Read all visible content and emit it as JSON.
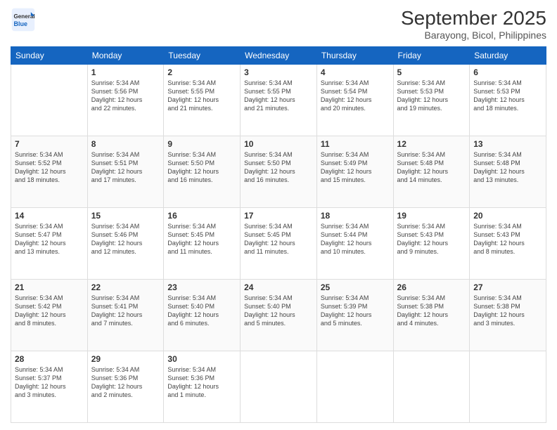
{
  "header": {
    "logo_general": "General",
    "logo_blue": "Blue",
    "month": "September 2025",
    "location": "Barayong, Bicol, Philippines"
  },
  "days_of_week": [
    "Sunday",
    "Monday",
    "Tuesday",
    "Wednesday",
    "Thursday",
    "Friday",
    "Saturday"
  ],
  "weeks": [
    [
      {
        "day": "",
        "info": ""
      },
      {
        "day": "1",
        "info": "Sunrise: 5:34 AM\nSunset: 5:56 PM\nDaylight: 12 hours\nand 22 minutes."
      },
      {
        "day": "2",
        "info": "Sunrise: 5:34 AM\nSunset: 5:55 PM\nDaylight: 12 hours\nand 21 minutes."
      },
      {
        "day": "3",
        "info": "Sunrise: 5:34 AM\nSunset: 5:55 PM\nDaylight: 12 hours\nand 21 minutes."
      },
      {
        "day": "4",
        "info": "Sunrise: 5:34 AM\nSunset: 5:54 PM\nDaylight: 12 hours\nand 20 minutes."
      },
      {
        "day": "5",
        "info": "Sunrise: 5:34 AM\nSunset: 5:53 PM\nDaylight: 12 hours\nand 19 minutes."
      },
      {
        "day": "6",
        "info": "Sunrise: 5:34 AM\nSunset: 5:53 PM\nDaylight: 12 hours\nand 18 minutes."
      }
    ],
    [
      {
        "day": "7",
        "info": "Sunrise: 5:34 AM\nSunset: 5:52 PM\nDaylight: 12 hours\nand 18 minutes."
      },
      {
        "day": "8",
        "info": "Sunrise: 5:34 AM\nSunset: 5:51 PM\nDaylight: 12 hours\nand 17 minutes."
      },
      {
        "day": "9",
        "info": "Sunrise: 5:34 AM\nSunset: 5:50 PM\nDaylight: 12 hours\nand 16 minutes."
      },
      {
        "day": "10",
        "info": "Sunrise: 5:34 AM\nSunset: 5:50 PM\nDaylight: 12 hours\nand 16 minutes."
      },
      {
        "day": "11",
        "info": "Sunrise: 5:34 AM\nSunset: 5:49 PM\nDaylight: 12 hours\nand 15 minutes."
      },
      {
        "day": "12",
        "info": "Sunrise: 5:34 AM\nSunset: 5:48 PM\nDaylight: 12 hours\nand 14 minutes."
      },
      {
        "day": "13",
        "info": "Sunrise: 5:34 AM\nSunset: 5:48 PM\nDaylight: 12 hours\nand 13 minutes."
      }
    ],
    [
      {
        "day": "14",
        "info": "Sunrise: 5:34 AM\nSunset: 5:47 PM\nDaylight: 12 hours\nand 13 minutes."
      },
      {
        "day": "15",
        "info": "Sunrise: 5:34 AM\nSunset: 5:46 PM\nDaylight: 12 hours\nand 12 minutes."
      },
      {
        "day": "16",
        "info": "Sunrise: 5:34 AM\nSunset: 5:45 PM\nDaylight: 12 hours\nand 11 minutes."
      },
      {
        "day": "17",
        "info": "Sunrise: 5:34 AM\nSunset: 5:45 PM\nDaylight: 12 hours\nand 11 minutes."
      },
      {
        "day": "18",
        "info": "Sunrise: 5:34 AM\nSunset: 5:44 PM\nDaylight: 12 hours\nand 10 minutes."
      },
      {
        "day": "19",
        "info": "Sunrise: 5:34 AM\nSunset: 5:43 PM\nDaylight: 12 hours\nand 9 minutes."
      },
      {
        "day": "20",
        "info": "Sunrise: 5:34 AM\nSunset: 5:43 PM\nDaylight: 12 hours\nand 8 minutes."
      }
    ],
    [
      {
        "day": "21",
        "info": "Sunrise: 5:34 AM\nSunset: 5:42 PM\nDaylight: 12 hours\nand 8 minutes."
      },
      {
        "day": "22",
        "info": "Sunrise: 5:34 AM\nSunset: 5:41 PM\nDaylight: 12 hours\nand 7 minutes."
      },
      {
        "day": "23",
        "info": "Sunrise: 5:34 AM\nSunset: 5:40 PM\nDaylight: 12 hours\nand 6 minutes."
      },
      {
        "day": "24",
        "info": "Sunrise: 5:34 AM\nSunset: 5:40 PM\nDaylight: 12 hours\nand 5 minutes."
      },
      {
        "day": "25",
        "info": "Sunrise: 5:34 AM\nSunset: 5:39 PM\nDaylight: 12 hours\nand 5 minutes."
      },
      {
        "day": "26",
        "info": "Sunrise: 5:34 AM\nSunset: 5:38 PM\nDaylight: 12 hours\nand 4 minutes."
      },
      {
        "day": "27",
        "info": "Sunrise: 5:34 AM\nSunset: 5:38 PM\nDaylight: 12 hours\nand 3 minutes."
      }
    ],
    [
      {
        "day": "28",
        "info": "Sunrise: 5:34 AM\nSunset: 5:37 PM\nDaylight: 12 hours\nand 3 minutes."
      },
      {
        "day": "29",
        "info": "Sunrise: 5:34 AM\nSunset: 5:36 PM\nDaylight: 12 hours\nand 2 minutes."
      },
      {
        "day": "30",
        "info": "Sunrise: 5:34 AM\nSunset: 5:36 PM\nDaylight: 12 hours\nand 1 minute."
      },
      {
        "day": "",
        "info": ""
      },
      {
        "day": "",
        "info": ""
      },
      {
        "day": "",
        "info": ""
      },
      {
        "day": "",
        "info": ""
      }
    ]
  ]
}
